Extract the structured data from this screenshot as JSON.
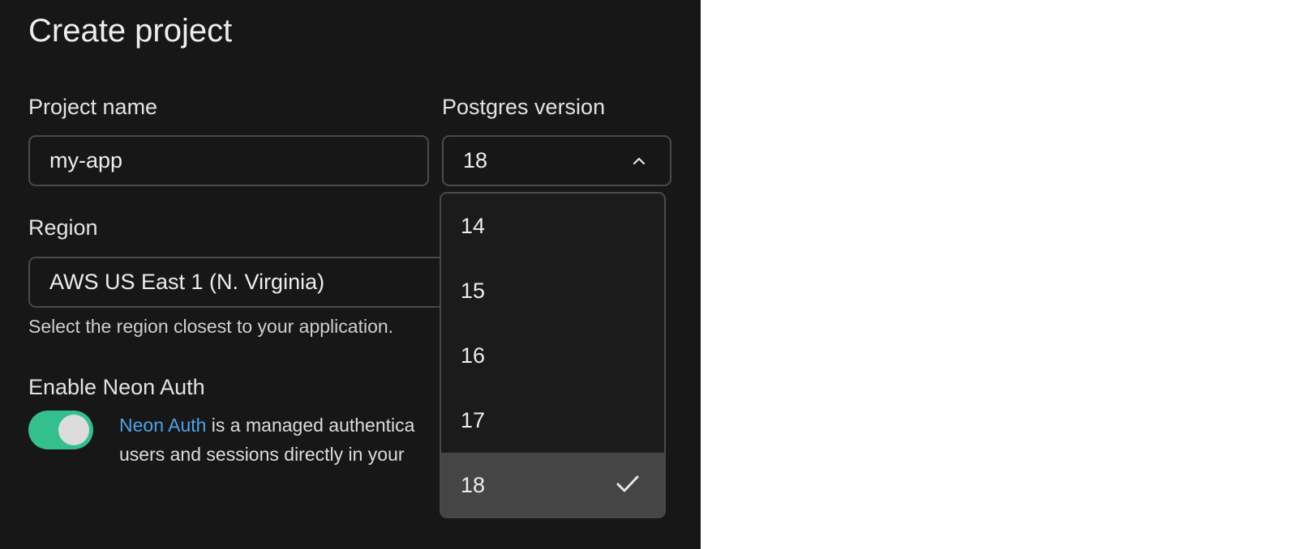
{
  "title": "Create project",
  "project_name": {
    "label": "Project name",
    "value": "my-app"
  },
  "postgres_version": {
    "label": "Postgres version",
    "selected": "18",
    "chevron_icon": "chevron-up-icon",
    "options": [
      "14",
      "15",
      "16",
      "17",
      "18"
    ],
    "check_icon": "check-icon"
  },
  "region": {
    "label": "Region",
    "value": "AWS US East 1 (N. Virginia)",
    "hint": "Select the region closest to your application."
  },
  "neon_auth": {
    "label": "Enable Neon Auth",
    "enabled": true,
    "link_text": "Neon Auth",
    "description_line1": " is a managed authentica",
    "description_line2": "users and sessions directly in your"
  },
  "colors": {
    "panel_bg": "#171717",
    "toggle_on": "#34c08e",
    "link": "#4ea1e8",
    "selected_option_bg": "#454545"
  }
}
